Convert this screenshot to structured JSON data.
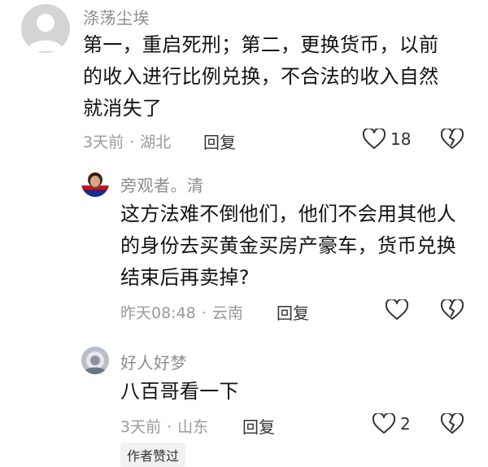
{
  "comments": [
    {
      "username": "涤荡尘埃",
      "lines": [
        "第一，重启死刑；第二，更换货币，以前",
        "的收入进行比例兑换，不合法的收入自然",
        "就消失了"
      ],
      "time": "3天前",
      "location": "湖北",
      "reply_label": "回复",
      "likes": "18",
      "avatar": "default-gray-avatar"
    },
    {
      "username": "旁观者。清",
      "lines": [
        "这方法难不倒他们，他们不会用其他人",
        "的身份去买黄金买房产豪车，货币兑换",
        "结束后再卖掉?"
      ],
      "time": "昨天08:48",
      "location": "云南",
      "reply_label": "回复",
      "likes": "",
      "avatar": "photo-avatar-red-blue"
    },
    {
      "username": "好人好梦",
      "lines": [
        "八百哥看一下"
      ],
      "time": "3天前",
      "location": "山东",
      "reply_label": "回复",
      "likes": "2",
      "author_tag": "作者赞过",
      "avatar": "photo-avatar-gray"
    }
  ],
  "separator": "·",
  "icons": {
    "like": "heart-outline-icon",
    "dislike": "broken-heart-icon"
  },
  "colors": {
    "username": "#8c8c8c",
    "meta": "#9a9a9a",
    "icon": "#333333",
    "author_tag_bg": "#f1f1f1"
  }
}
